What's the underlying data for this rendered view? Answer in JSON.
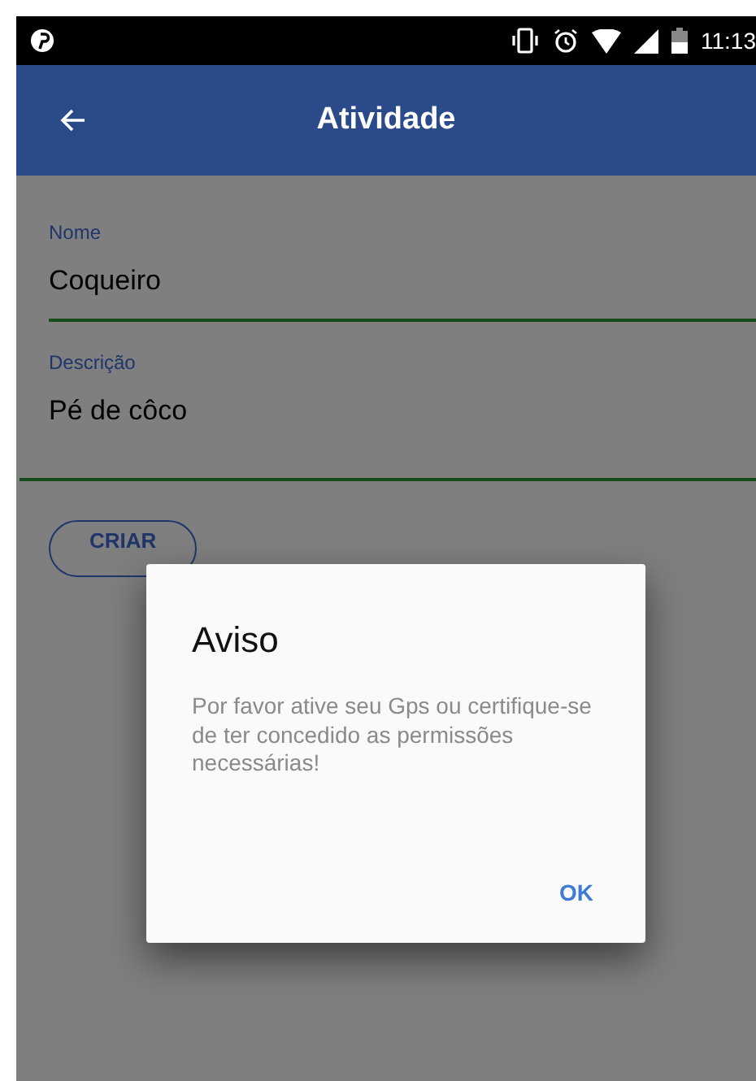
{
  "status_bar": {
    "time": "11:13"
  },
  "app_bar": {
    "title": "Atividade"
  },
  "form": {
    "fields": [
      {
        "kind": "single",
        "label": "Nome",
        "value": "Coqueiro"
      },
      {
        "kind": "multiline",
        "label": "Descrição",
        "value": "Pé de côco"
      }
    ],
    "submit_button": "CRIAR"
  },
  "dialog": {
    "title": "Aviso",
    "message": "Por favor ative seu Gps ou certifique-se de ter concedido as permissões necessárias!",
    "buttons": [
      "OK"
    ]
  }
}
